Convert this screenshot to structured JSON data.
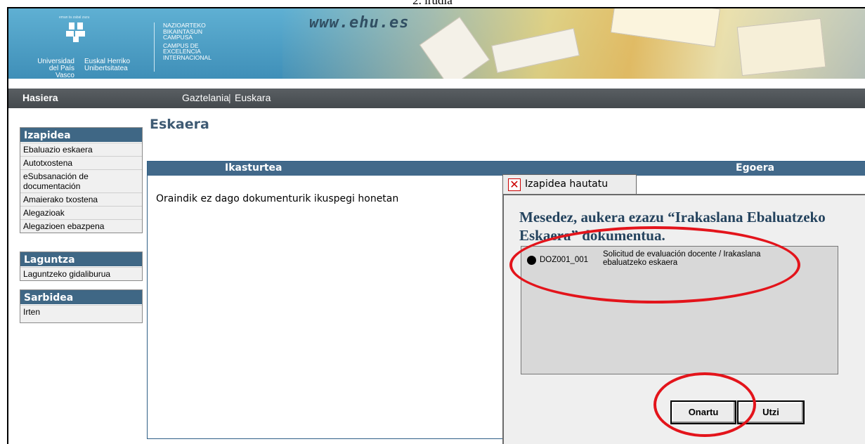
{
  "caption": "2. irudia",
  "banner": {
    "logo_tiny": "eman ta zabal zazu",
    "logo_left_1": "Universidad",
    "logo_left_2": "del País Vasco",
    "logo_right_1": "Euskal Herriko",
    "logo_right_2": "Unibertsitatea",
    "campus_lines": [
      "NAZIOARTEKO",
      "BIKAINTASUN",
      "CAMPUSA"
    ],
    "campus_lines_b": [
      "CAMPUS DE",
      "EXCELENCIA",
      "INTERNACIONAL"
    ],
    "website": "www.ehu.es"
  },
  "nav": {
    "home": "Hasiera",
    "lang_es": "Gaztelania",
    "separator": "|",
    "lang_eu": "Euskara"
  },
  "sidebar": {
    "sections": [
      {
        "title": "Izapidea",
        "items": [
          "Ebaluazio eskaera",
          "Autotxostena",
          "eSubsanación de documentación",
          "Amaierako txostena",
          "Alegazioak",
          "Alegazioen ebazpena"
        ]
      },
      {
        "title": "Laguntza",
        "items": [
          "Laguntzeko gidaliburua"
        ]
      },
      {
        "title": "Sarbidea",
        "items": [
          "Irten"
        ]
      }
    ]
  },
  "main": {
    "title": "Eskaera",
    "columns": [
      "Ikasturtea",
      "Egoera"
    ],
    "empty_message": "Oraindik ez dago dokumenturik ikuspegi honetan"
  },
  "dialog": {
    "tab_label": "Izapidea hautatu",
    "close_glyph": "✕",
    "message": "Mesedez, aukera ezazu “Irakaslana Ebaluatzeko Eskaera” dokumentua.",
    "option_code": "DOZ001_001",
    "option_desc": "Solicitud de evaluación docente / Irakaslana ebaluatzeko eskaera",
    "ok_label": "Onartu",
    "cancel_label": "Utzi"
  },
  "colors": {
    "annotation": "#e3141b",
    "header_blue": "#42698a",
    "nav_grey": "#4d5256"
  }
}
